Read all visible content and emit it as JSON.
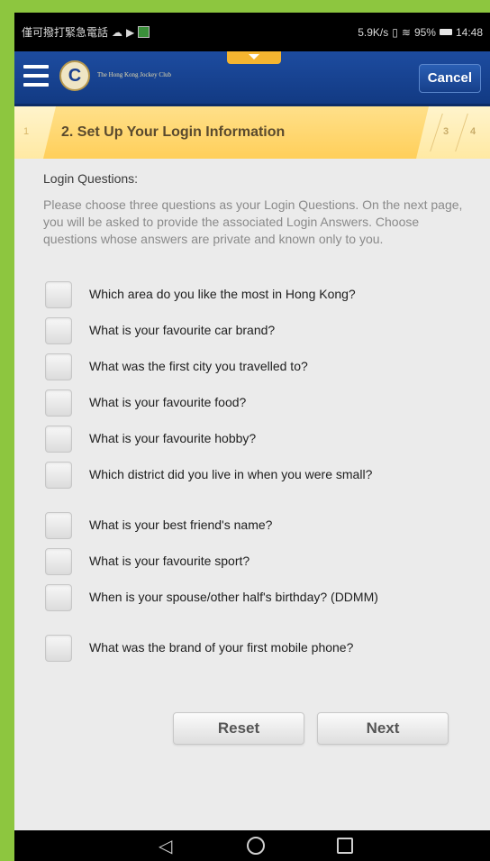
{
  "statusbar": {
    "left_text": "僅可撥打緊急電話",
    "right_text": "5.9K/s",
    "battery": "95%",
    "time": "14:48"
  },
  "appbar": {
    "brand": "The Hong Kong Jockey Club",
    "cancel_label": "Cancel"
  },
  "steps": {
    "step1": "1",
    "active": "2. Set Up Your Login Information",
    "step3": "3",
    "step4": "4"
  },
  "content": {
    "title": "Login Questions:",
    "description": "Please choose three questions as your Login Questions. On the next page, you will be asked to provide the associated Login Answers. Choose questions whose answers are private and known only to you.",
    "questions": [
      "Which area do you like the most in Hong Kong?",
      "What is your favourite car brand?",
      "What was the first city you travelled to?",
      "What is your favourite food?",
      "What is your favourite hobby?",
      "Which district did you live in when you were small?",
      "What is your best friend's name?",
      "What is your favourite sport?",
      "When is your spouse/other half's birthday? (DDMM)",
      "What was the brand of your first mobile phone?"
    ],
    "reset_label": "Reset",
    "next_label": "Next"
  },
  "colors": {
    "frame": "#8dc63f",
    "appbar": "#1d4ca0",
    "step_active": "#ffd56a"
  }
}
